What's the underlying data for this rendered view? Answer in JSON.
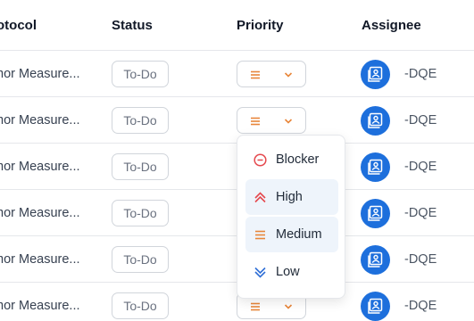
{
  "header": {
    "protocol": "otocol",
    "status": "Status",
    "priority": "Priority",
    "assignee": "Assignee"
  },
  "rows": [
    {
      "protocol": "mor Measure...",
      "status": "To-Do",
      "assignee": "-DQE"
    },
    {
      "protocol": "mor Measure...",
      "status": "To-Do",
      "assignee": "-DQE"
    },
    {
      "protocol": "mor Measure...",
      "status": "To-Do",
      "assignee": "-DQE"
    },
    {
      "protocol": "mor Measure...",
      "status": "To-Do",
      "assignee": "-DQE"
    },
    {
      "protocol": "mor Measure...",
      "status": "To-Do",
      "assignee": "-DQE"
    },
    {
      "protocol": "mor Measure...",
      "status": "To-Do",
      "assignee": "-DQE"
    }
  ],
  "priority_dropdown": {
    "options": [
      {
        "label": "Blocker",
        "icon": "blocker-icon",
        "color": "#e5484d"
      },
      {
        "label": "High",
        "icon": "high-priority-icon",
        "color": "#e5484d"
      },
      {
        "label": "Medium",
        "icon": "medium-priority-icon",
        "color": "#e8863a"
      },
      {
        "label": "Low",
        "icon": "low-priority-icon",
        "color": "#2f6fd6"
      }
    ]
  },
  "colors": {
    "accent": "#1d6fdc",
    "medium": "#e8863a",
    "highlight": "#eef4fb"
  }
}
